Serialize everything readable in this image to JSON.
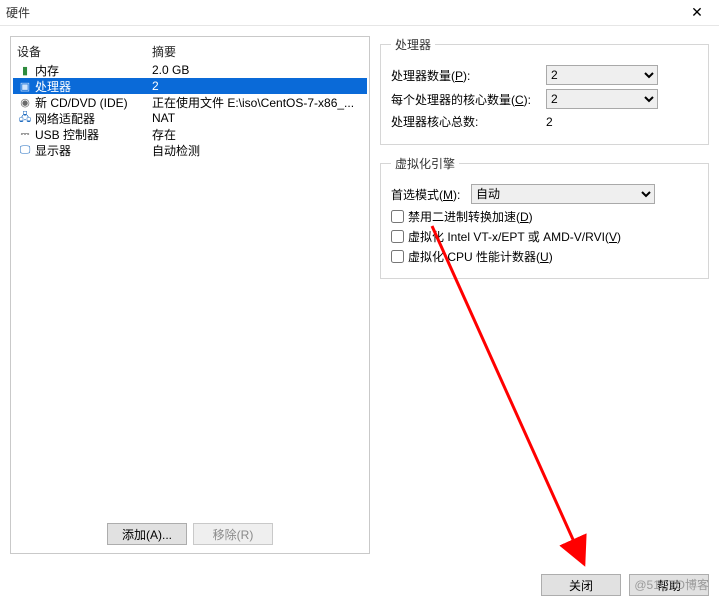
{
  "window": {
    "title": "硬件"
  },
  "columns": {
    "device": "设备",
    "summary": "摘要"
  },
  "devices": [
    {
      "icon": "memory-icon",
      "name": "内存",
      "summary": "2.0 GB",
      "selected": false
    },
    {
      "icon": "cpu-icon",
      "name": "处理器",
      "summary": "2",
      "selected": true
    },
    {
      "icon": "cd-icon",
      "name": "新 CD/DVD (IDE)",
      "summary": "正在使用文件 E:\\iso\\CentOS-7-x86_...",
      "selected": false
    },
    {
      "icon": "network-icon",
      "name": "网络适配器",
      "summary": "NAT",
      "selected": false
    },
    {
      "icon": "usb-icon",
      "name": "USB 控制器",
      "summary": "存在",
      "selected": false
    },
    {
      "icon": "display-icon",
      "name": "显示器",
      "summary": "自动检测",
      "selected": false
    }
  ],
  "buttons": {
    "add": "添加(A)...",
    "remove": "移除(R)",
    "close": "关闭",
    "help": "帮助"
  },
  "processor": {
    "legend": "处理器",
    "count_label": "处理器数量(P):",
    "count_value": "2",
    "cores_label": "每个处理器的核心数量(C):",
    "cores_value": "2",
    "total_label": "处理器核心总数:",
    "total_value": "2"
  },
  "virt": {
    "legend": "虚拟化引擎",
    "mode_label": "首选模式(M):",
    "mode_value": "自动",
    "opt1": "禁用二进制转换加速(D)",
    "opt2": "虚拟化 Intel VT-x/EPT 或 AMD-V/RVI(V)",
    "opt3": "虚拟化 CPU 性能计数器(U)"
  },
  "watermark": "@51CTO博客"
}
